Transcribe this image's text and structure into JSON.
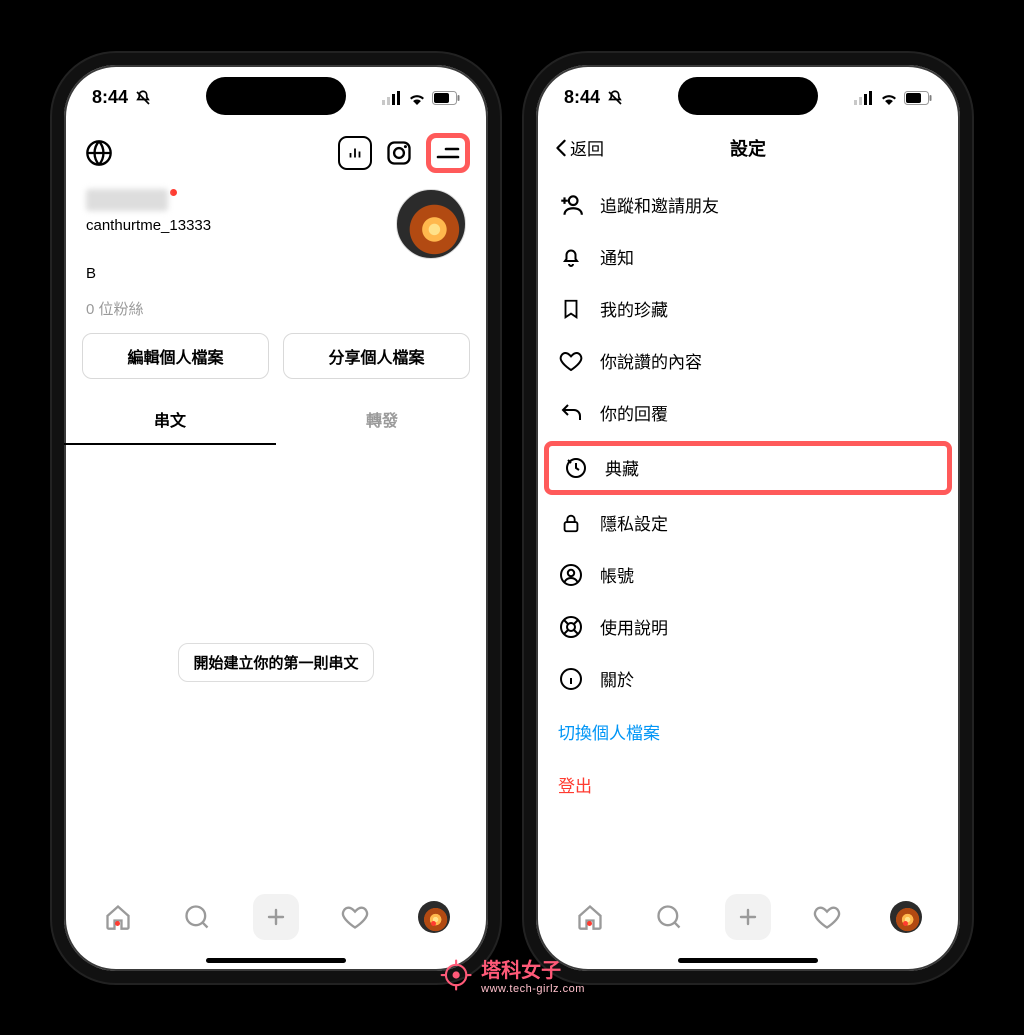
{
  "status": {
    "time": "8:44"
  },
  "profile": {
    "handle": "canthurtme_13333",
    "bio": "B",
    "followers": "0 位粉絲",
    "edit_profile": "編輯個人檔案",
    "share_profile": "分享個人檔案",
    "tab_posts": "串文",
    "tab_reposts": "轉發",
    "empty_cta": "開始建立你的第一則串文"
  },
  "settings": {
    "back": "返回",
    "title": "設定",
    "items": {
      "follow_invite": "追蹤和邀請朋友",
      "notifications": "通知",
      "saved": "我的珍藏",
      "liked": "你說讚的內容",
      "your_replies": "你的回覆",
      "archive": "典藏",
      "privacy": "隱私設定",
      "account": "帳號",
      "help": "使用說明",
      "about": "關於"
    },
    "switch_profile": "切換個人檔案",
    "logout": "登出"
  },
  "watermark": {
    "title": "塔科女子",
    "url": "www.tech-girlz.com"
  }
}
